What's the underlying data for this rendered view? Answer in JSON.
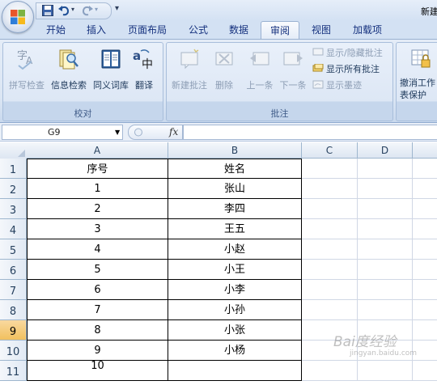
{
  "window": {
    "title": "新建"
  },
  "tabs": [
    "开始",
    "插入",
    "页面布局",
    "公式",
    "数据",
    "审阅",
    "视图",
    "加载项"
  ],
  "active_tab": "审阅",
  "ribbon": {
    "proofing": {
      "label": "校对",
      "buttons": [
        "拼写检查",
        "信息检索",
        "同义词库",
        "翻译"
      ]
    },
    "comments": {
      "label": "批注",
      "buttons": [
        "新建批注",
        "删除",
        "上一条",
        "下一条"
      ],
      "small": [
        "显示/隐藏批注",
        "显示所有批注",
        "显示墨迹"
      ]
    },
    "changes": {
      "button": [
        "撤消工作",
        "表保护"
      ]
    }
  },
  "formula_bar": {
    "name_box": "G9",
    "fx": "fx",
    "content": ""
  },
  "columns": [
    "A",
    "B",
    "C",
    "D"
  ],
  "rows": [
    "1",
    "2",
    "3",
    "4",
    "5",
    "6",
    "7",
    "8",
    "9",
    "10",
    "11"
  ],
  "active_row": "9",
  "table": [
    [
      "序号",
      "姓名"
    ],
    [
      "1",
      "张山"
    ],
    [
      "2",
      "李四"
    ],
    [
      "3",
      "王五"
    ],
    [
      "4",
      "小赵"
    ],
    [
      "5",
      "小王"
    ],
    [
      "6",
      "小李"
    ],
    [
      "7",
      "小孙"
    ],
    [
      "8",
      "小张"
    ],
    [
      "9",
      "小杨"
    ],
    [
      "10",
      ""
    ]
  ],
  "watermark": {
    "text": "Bai度经验",
    "sub": "jingyan.baidu.com"
  },
  "colors": {
    "ribbon": "#dbe6f4",
    "active_row_header": "#f1c15f",
    "grid_line": "#d0d7e5"
  }
}
